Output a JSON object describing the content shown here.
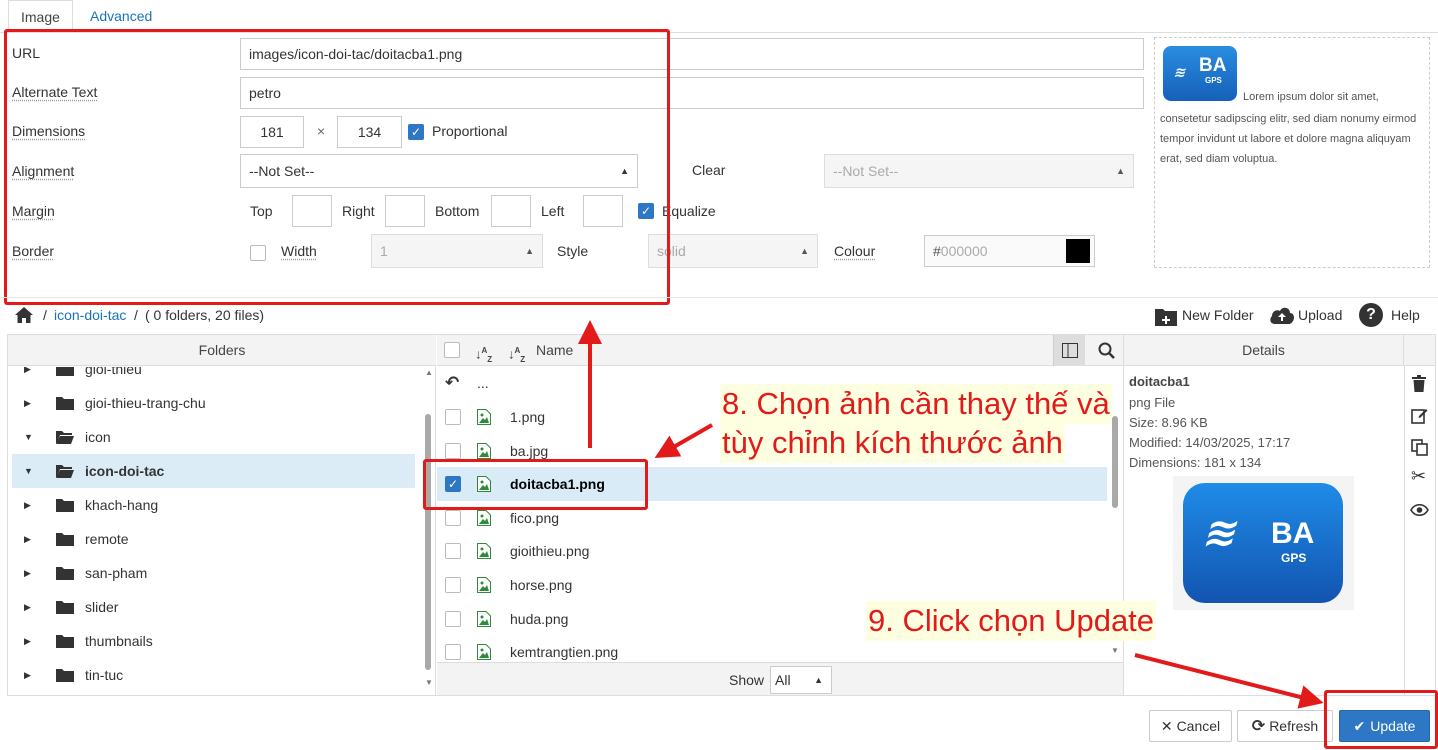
{
  "tabs": [
    "Image",
    "Advanced"
  ],
  "form": {
    "url_label": "URL",
    "url_value": "images/icon-doi-tac/doitacba1.png",
    "alt_label": "Alternate Text",
    "alt_value": "petro",
    "dimensions_label": "Dimensions",
    "width_value": "181",
    "times": "×",
    "height_value": "134",
    "proportional_label": "Proportional",
    "alignment_label": "Alignment",
    "alignment_value": "--Not Set--",
    "clear_label": "Clear",
    "clear_value": "--Not Set--",
    "margin_label": "Margin",
    "top_label": "Top",
    "right_label": "Right",
    "bottom_label": "Bottom",
    "left_label": "Left",
    "equalize_label": "Equalize",
    "border_label": "Border",
    "width_label": "Width",
    "border_width_value": "1",
    "style_label": "Style",
    "style_value": "solid",
    "colour_label": "Colour",
    "colour_hash": "#",
    "colour_placeholder": "000000",
    "colour_swatch": "#000000"
  },
  "preview": {
    "logo_text": "BA",
    "logo_sub": "GPS",
    "lorem_first": "Lorem ipsum dolor sit amet,",
    "lorem_rest": "consetetur sadipscing elitr, sed diam nonumy eirmod tempor invidunt ut labore et dolore magna aliquyam erat, sed diam voluptua."
  },
  "breadcrumb": {
    "sep1": "/",
    "folder": "icon-doi-tac",
    "sep2": "/",
    "info": "( 0 folders, 20 files)"
  },
  "toolbar": {
    "new_folder": "New Folder",
    "upload": "Upload",
    "help": "Help"
  },
  "folders": {
    "header": "Folders",
    "items": [
      {
        "label": "gioi-thieu",
        "state": "collapsed"
      },
      {
        "label": "gioi-thieu-trang-chu",
        "state": "collapsed"
      },
      {
        "label": "icon",
        "state": "expanded"
      },
      {
        "label": "icon-doi-tac",
        "state": "expanded-selected"
      },
      {
        "label": "khach-hang",
        "state": "collapsed"
      },
      {
        "label": "remote",
        "state": "collapsed"
      },
      {
        "label": "san-pham",
        "state": "collapsed"
      },
      {
        "label": "slider",
        "state": "collapsed"
      },
      {
        "label": "thumbnails",
        "state": "collapsed"
      },
      {
        "label": "tin-tuc",
        "state": "collapsed"
      }
    ]
  },
  "files": {
    "name_header": "Name",
    "up_label": "...",
    "items": [
      {
        "label": "1.png",
        "selected": false
      },
      {
        "label": "ba.jpg",
        "selected": false
      },
      {
        "label": "doitacba1.png",
        "selected": true
      },
      {
        "label": "fico.png",
        "selected": false
      },
      {
        "label": "gioithieu.png",
        "selected": false
      },
      {
        "label": "horse.png",
        "selected": false
      },
      {
        "label": "huda.png",
        "selected": false
      },
      {
        "label": "kemtrangtien.png",
        "selected": false
      }
    ],
    "show_label": "Show",
    "show_value": "All"
  },
  "details": {
    "header": "Details",
    "name": "doitacba1",
    "type": "png File",
    "size": "Size: 8.96 KB",
    "modified": "Modified: 14/03/2025, 17:17",
    "dimensions": "Dimensions: 181 x 134",
    "logo_text": "BA",
    "logo_sub": "GPS"
  },
  "buttons": {
    "cancel": "Cancel",
    "refresh": "Refresh",
    "update": "Update"
  },
  "annotations": {
    "step8_line1": "8. Chọn ảnh cần thay thế và",
    "step8_line2": "tùy chỉnh kích thước ảnh",
    "step9": "9. Click chọn Update"
  },
  "colors": {
    "accent": "#2e77c4",
    "annotation_red": "#e31a1a",
    "annotation_bg": "#fefee0"
  }
}
